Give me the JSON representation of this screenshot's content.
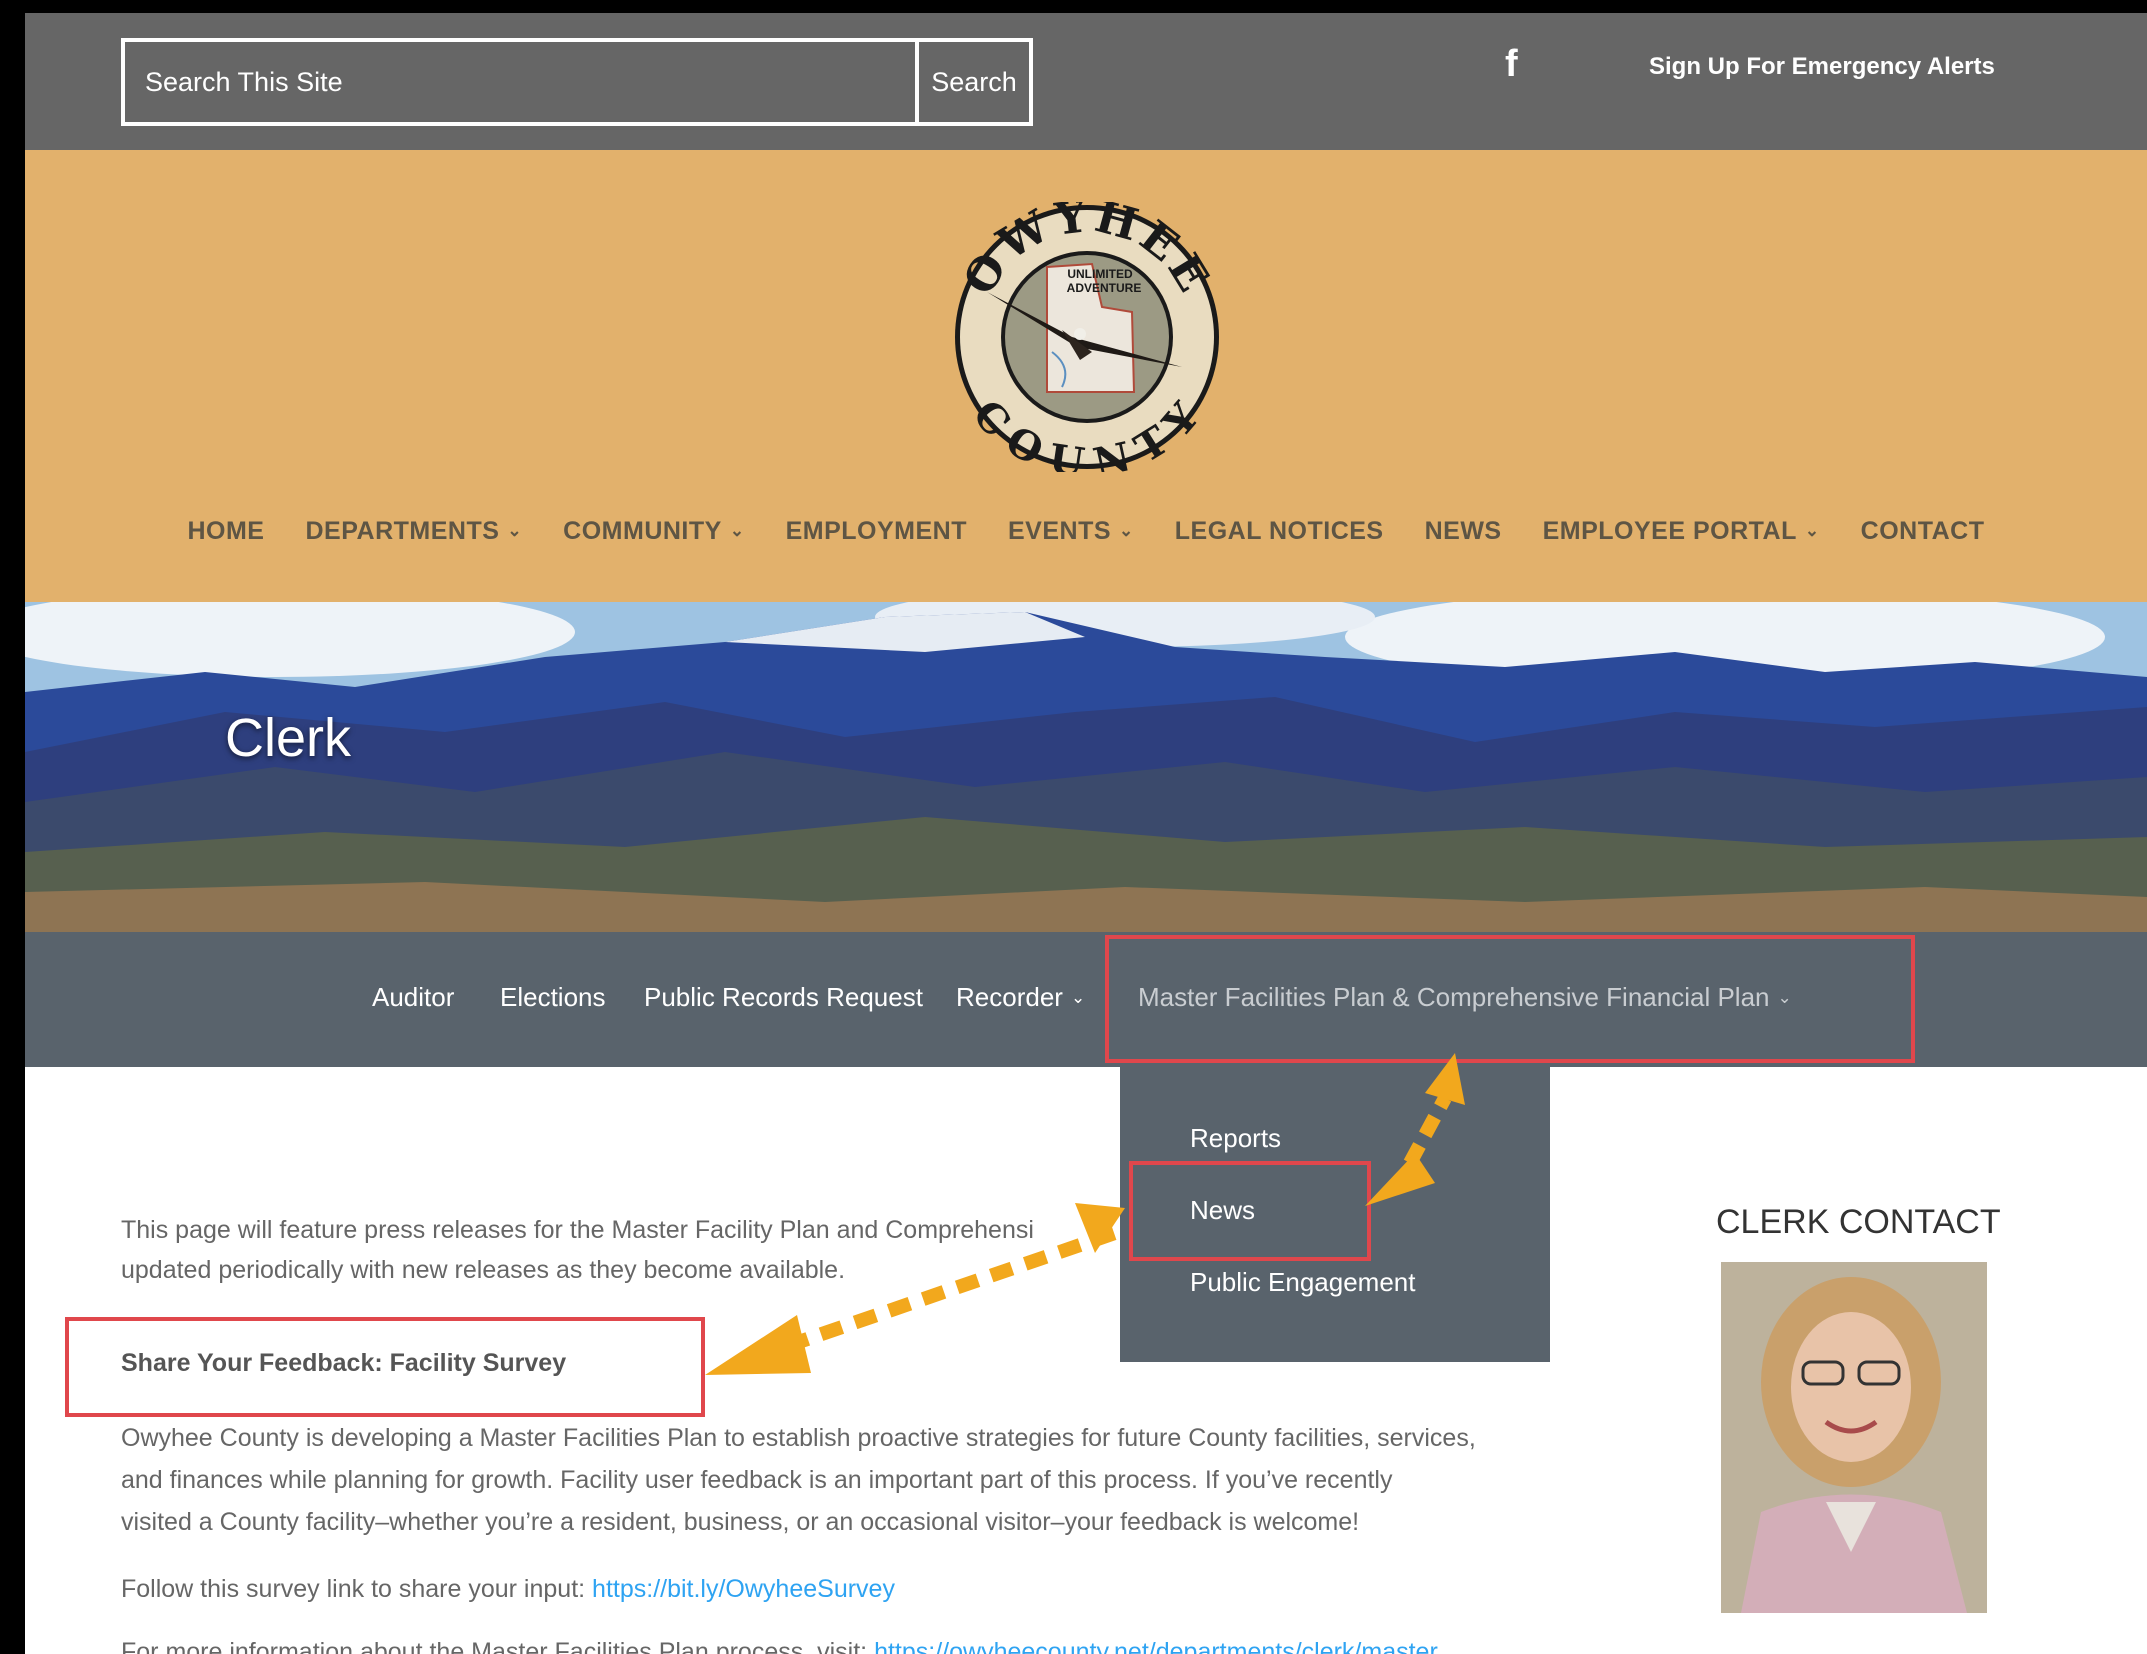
{
  "search": {
    "placeholder": "Search This Site",
    "button_label": "Search"
  },
  "topbar": {
    "facebook_icon": "f",
    "alerts_label": "Sign Up For Emergency Alerts"
  },
  "logo": {
    "text_top": "OWYHEE",
    "text_bottom": "COUNTY",
    "tagline_1": "UNLIMITED",
    "tagline_2": "ADVENTURE"
  },
  "main_nav": [
    {
      "label": "HOME",
      "has_dropdown": false
    },
    {
      "label": "DEPARTMENTS",
      "has_dropdown": true
    },
    {
      "label": "COMMUNITY",
      "has_dropdown": true
    },
    {
      "label": "EMPLOYMENT",
      "has_dropdown": false
    },
    {
      "label": "EVENTS",
      "has_dropdown": true
    },
    {
      "label": "LEGAL NOTICES",
      "has_dropdown": false
    },
    {
      "label": "NEWS",
      "has_dropdown": false
    },
    {
      "label": "EMPLOYEE PORTAL",
      "has_dropdown": true
    },
    {
      "label": "CONTACT",
      "has_dropdown": false
    }
  ],
  "hero": {
    "title": "Clerk"
  },
  "sub_nav": {
    "auditor": "Auditor",
    "elections": "Elections",
    "public_records": "Public Records Request",
    "recorder": "Recorder",
    "master_plan": "Master Facilities Plan & Comprehensive Financial Plan"
  },
  "dropdown": {
    "reports": "Reports",
    "news": "News",
    "public_engagement": "Public Engagement"
  },
  "content": {
    "intro_line_1": "This page will feature press releases for the Master Facility Plan and Comprehensi",
    "intro_line_2": "updated periodically with new releases as they become available.",
    "feedback_heading": "Share Your Feedback: Facility Survey",
    "para_line_1": "Owyhee County is developing a Master Facilities Plan to establish proactive strategies for future County facilities, services,",
    "para_line_2": "and finances while planning for growth. Facility user feedback is an important part of this process. If you’ve recently",
    "para_line_3": "visited a County facility–whether you’re a resident, business, or an occasional visitor–your feedback is welcome!",
    "survey_prefix": "Follow this survey link to share your input: ",
    "survey_link": "https://bit.ly/OwyheeSurvey",
    "more_prefix": "For more information about the Master Facilities Plan process, visit: ",
    "more_link": "https://owyheecounty.net/departments/clerk/master"
  },
  "sidebar": {
    "heading": "CLERK CONTACT"
  },
  "colors": {
    "topbar": "#666666",
    "header": "#e2b16c",
    "nav_text": "#5e5544",
    "subnav": "#59636c",
    "highlight": "#e0474c",
    "arrow": "#f2a81d",
    "link": "#2ea3f2"
  }
}
